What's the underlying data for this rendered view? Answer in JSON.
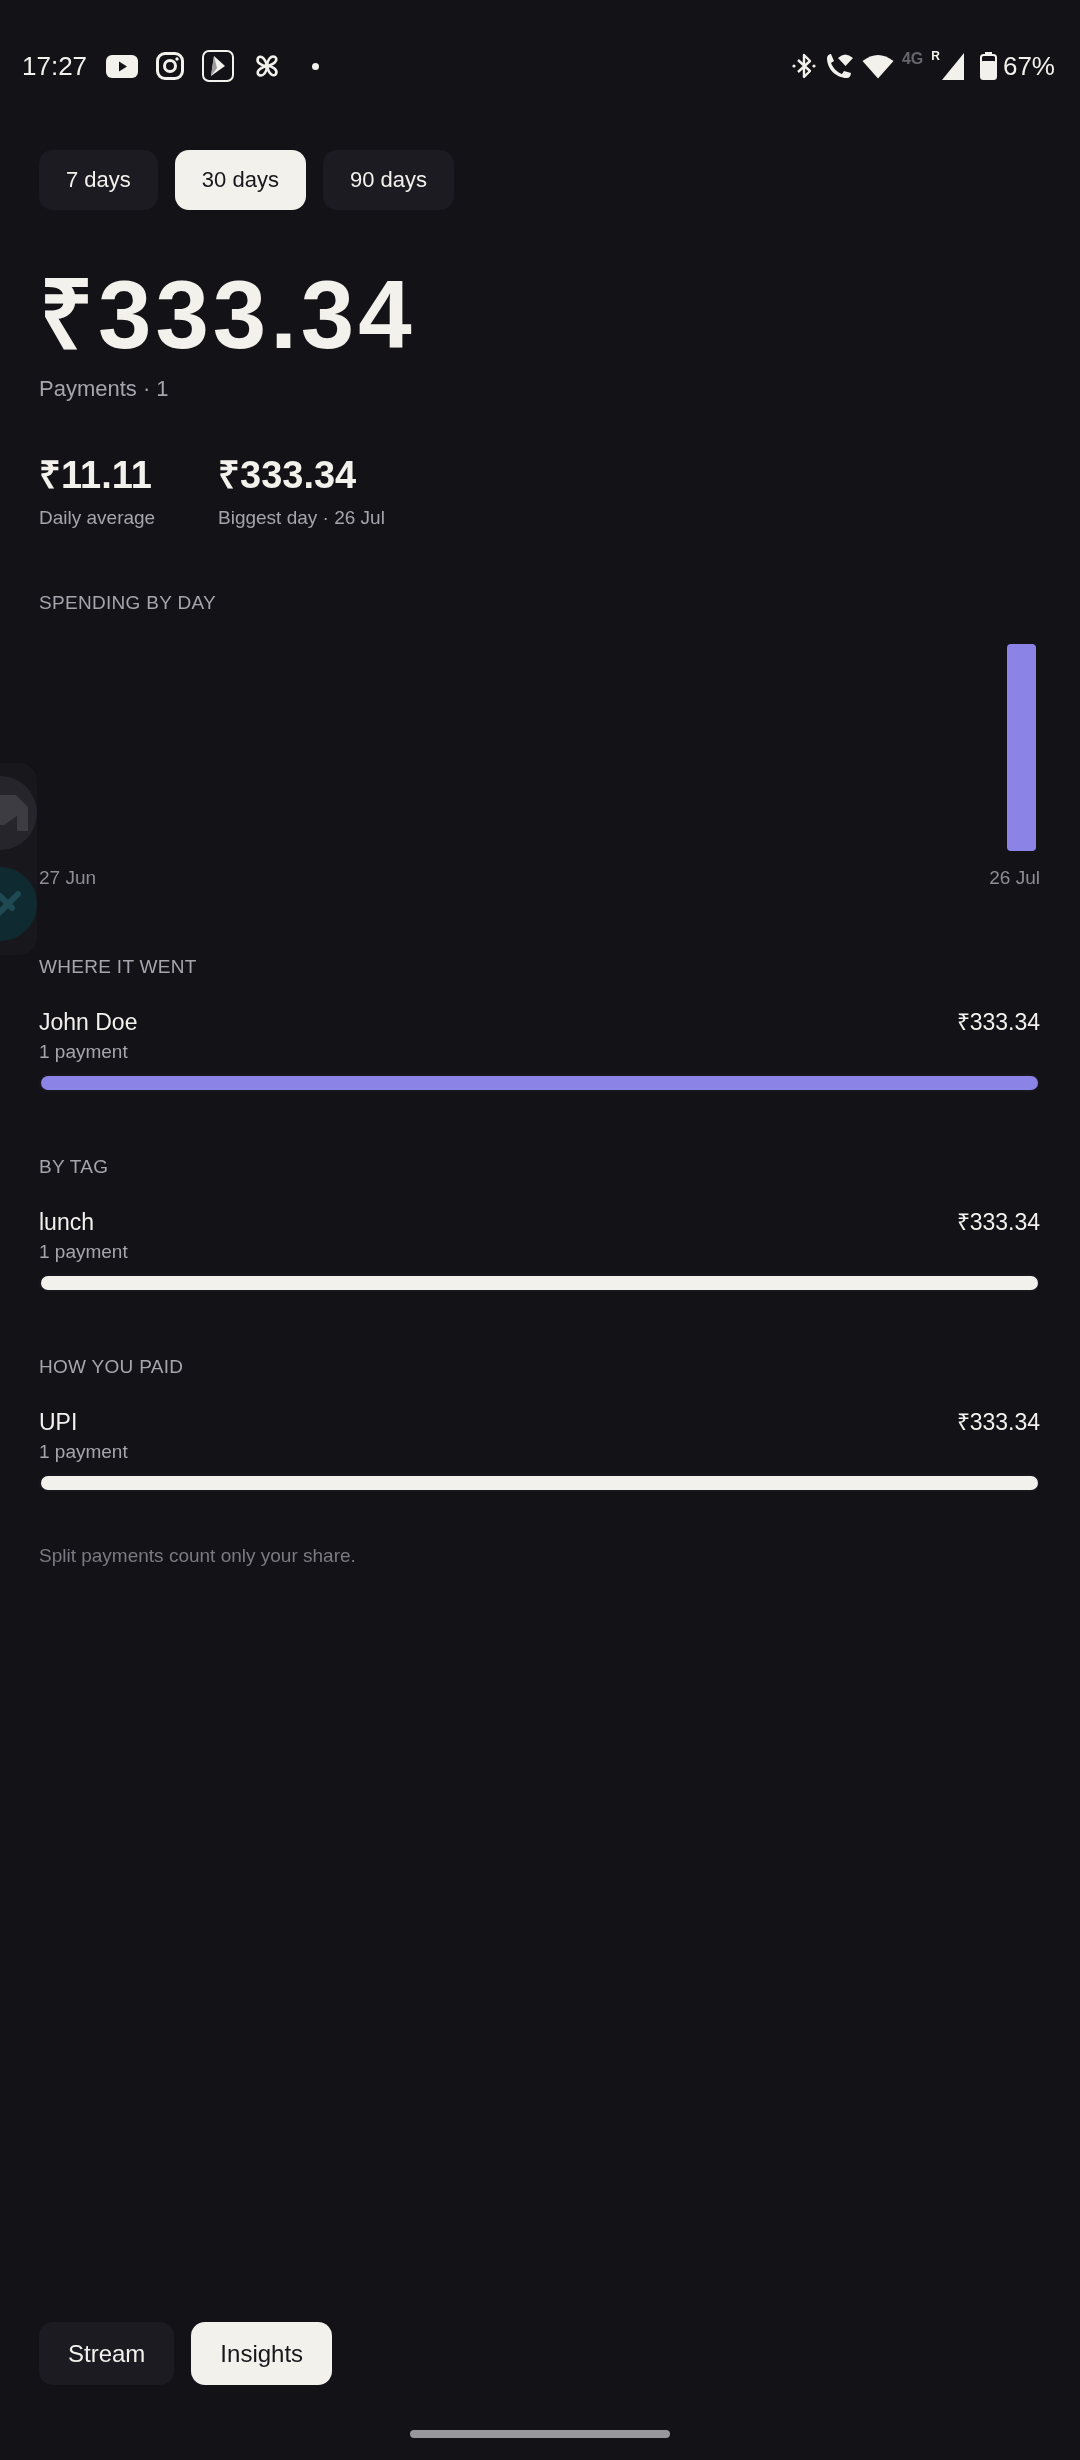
{
  "status_bar": {
    "time": "17:27",
    "network_type": "4G",
    "roaming": "R",
    "battery": "67%"
  },
  "range_tabs": [
    {
      "label": "7 days",
      "selected": false
    },
    {
      "label": "30 days",
      "selected": true
    },
    {
      "label": "90 days",
      "selected": false
    }
  ],
  "total": {
    "amount": "₹333.34",
    "caption": "Payments · 1"
  },
  "stats": [
    {
      "value": "₹11.11",
      "label": "Daily average"
    },
    {
      "value": "₹333.34",
      "label": "Biggest day · 26 Jul"
    }
  ],
  "spending_by_day": {
    "title": "SPENDING BY DAY",
    "start_label": "27 Jun",
    "end_label": "26 Jul"
  },
  "sections": [
    {
      "title": "WHERE IT WENT",
      "rows": [
        {
          "name": "John Doe",
          "amount": "₹333.34",
          "count": "1 payment",
          "level": 1,
          "color": "#8b83e6"
        }
      ]
    },
    {
      "title": "BY TAG",
      "rows": [
        {
          "name": "lunch",
          "amount": "₹333.34",
          "count": "1 payment",
          "level": 1,
          "color": "#f2f1ec"
        }
      ]
    },
    {
      "title": "HOW YOU PAID",
      "rows": [
        {
          "name": "UPI",
          "amount": "₹333.34",
          "count": "1 payment",
          "level": 1,
          "color": "#f2f1ec"
        }
      ]
    }
  ],
  "footnote": "Split payments count only your share.",
  "bottom_tabs": [
    {
      "label": "Stream",
      "selected": false
    },
    {
      "label": "Insights",
      "selected": true
    }
  ]
}
